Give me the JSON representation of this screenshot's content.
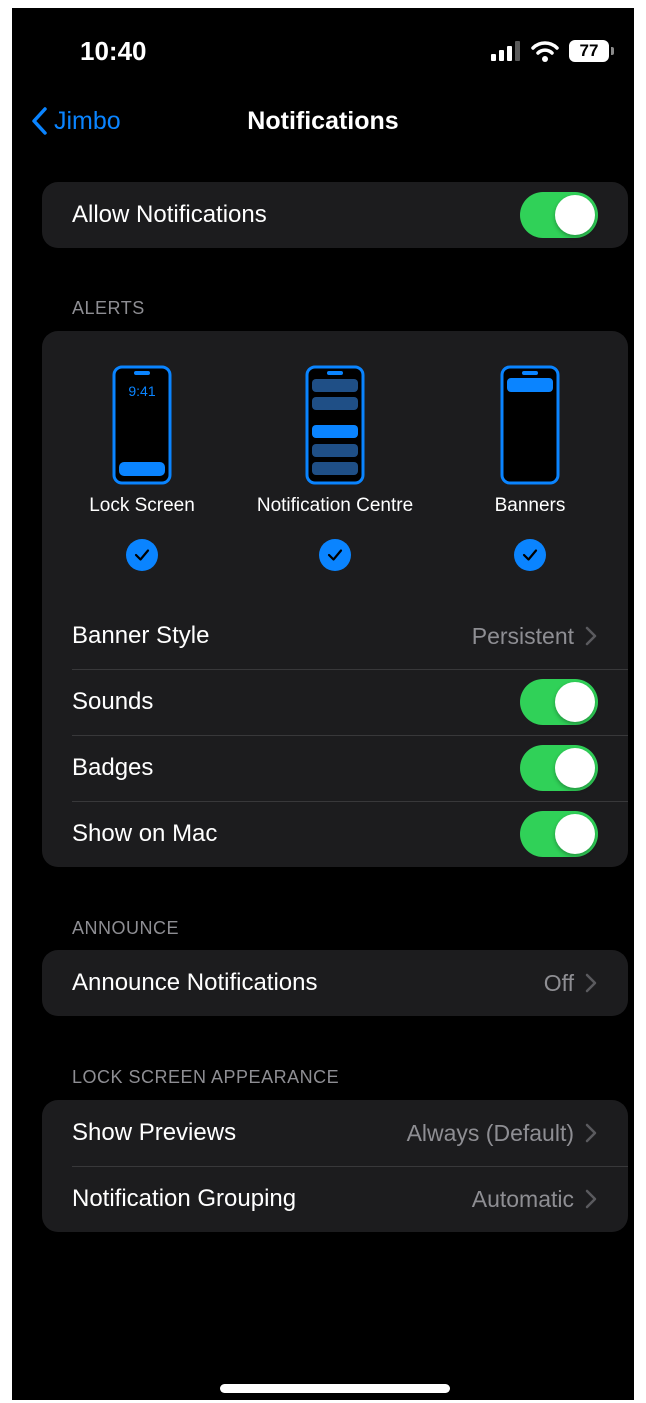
{
  "status_bar": {
    "time": "10:40",
    "battery": "77"
  },
  "nav": {
    "back_label": "Jimbo",
    "title": "Notifications"
  },
  "allow_notifications": {
    "label": "Allow Notifications",
    "enabled": true
  },
  "alerts": {
    "header": "ALERTS",
    "options": [
      {
        "label": "Lock Screen",
        "checked": true,
        "preview_time": "9:41"
      },
      {
        "label": "Notification Centre",
        "checked": true
      },
      {
        "label": "Banners",
        "checked": true
      }
    ],
    "banner_style": {
      "label": "Banner Style",
      "value": "Persistent"
    },
    "sounds": {
      "label": "Sounds",
      "enabled": true
    },
    "badges": {
      "label": "Badges",
      "enabled": true
    },
    "show_on_mac": {
      "label": "Show on Mac",
      "enabled": true
    }
  },
  "announce": {
    "header": "ANNOUNCE",
    "announce_notifications": {
      "label": "Announce Notifications",
      "value": "Off"
    }
  },
  "lock_screen_appearance": {
    "header": "LOCK SCREEN APPEARANCE",
    "show_previews": {
      "label": "Show Previews",
      "value": "Always (Default)"
    },
    "notification_grouping": {
      "label": "Notification Grouping",
      "value": "Automatic"
    }
  },
  "colors": {
    "accent": "#0a84ff",
    "toggle_on": "#30d158",
    "group_bg": "#1c1c1e",
    "secondary_text": "#8e8e93"
  }
}
